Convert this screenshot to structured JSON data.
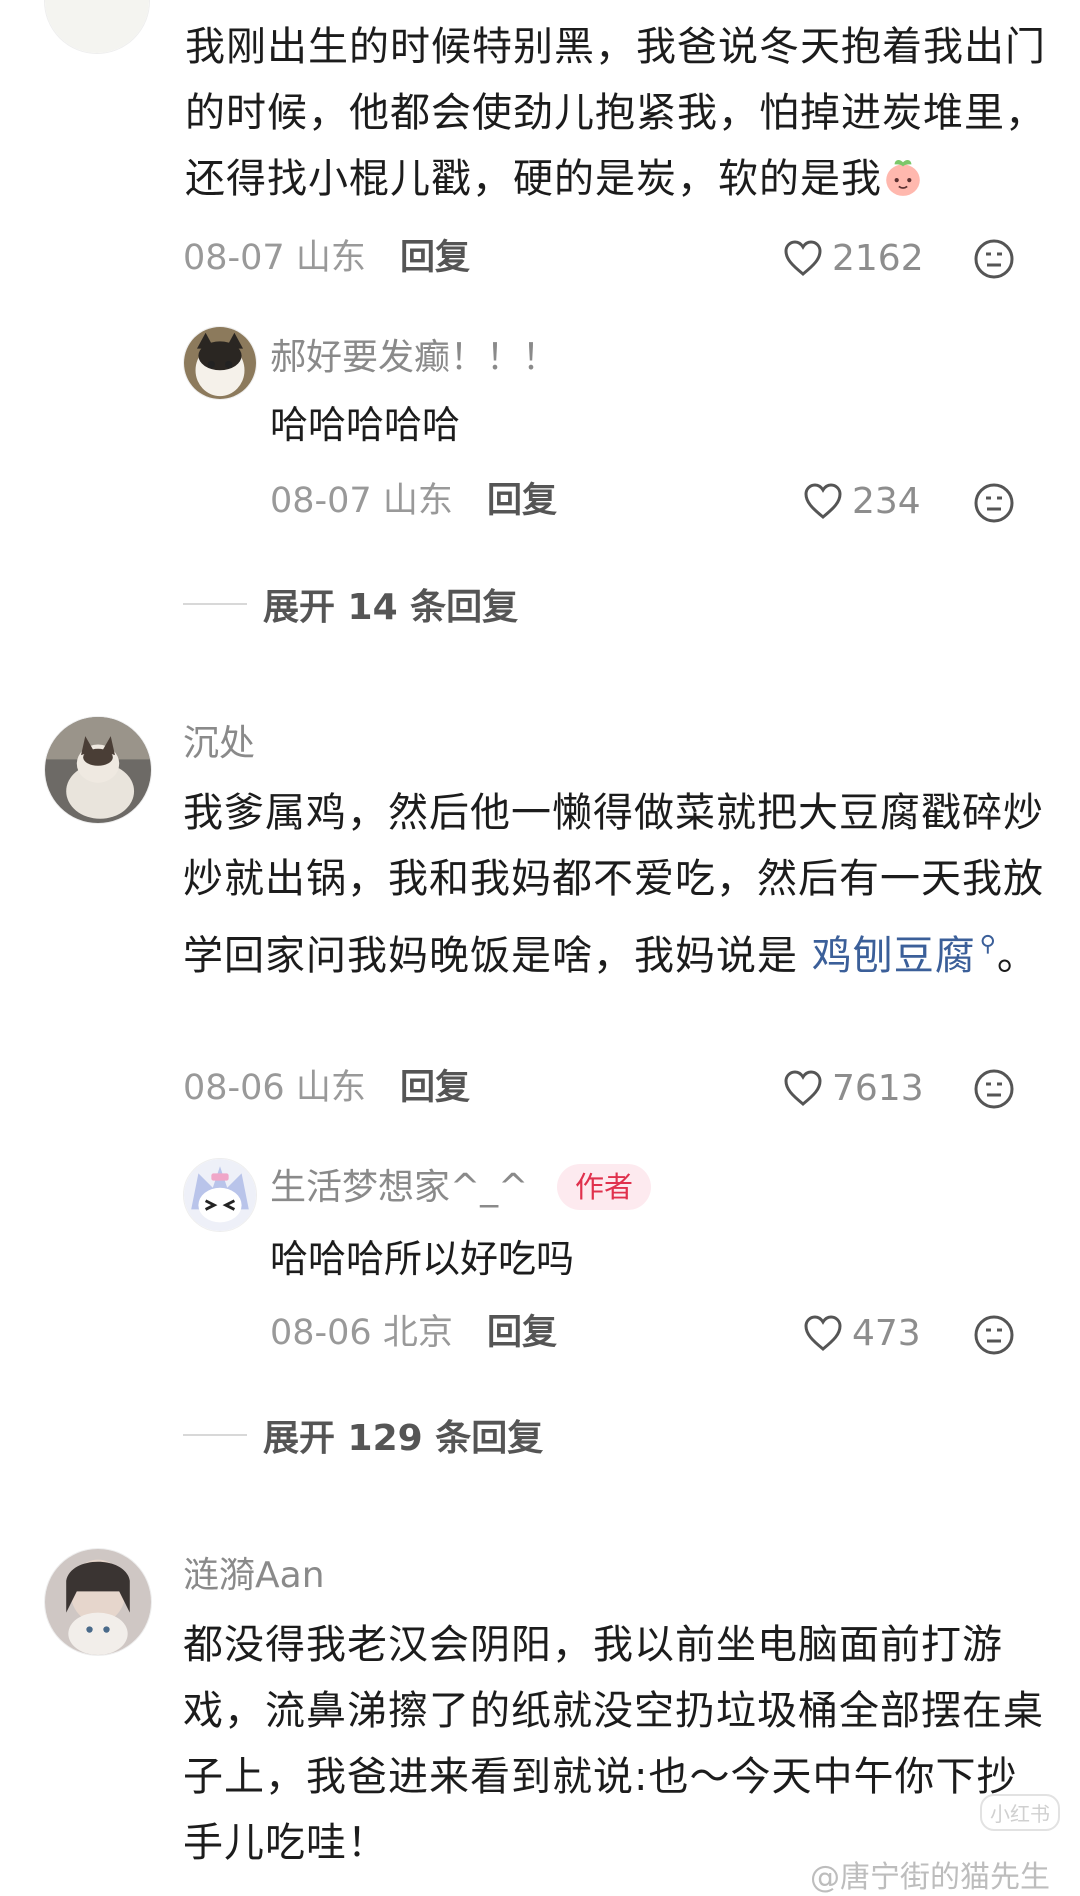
{
  "comments": [
    {
      "text": "我刚出生的时候特别黑，我爸说冬天抱着我出门的时候，他都会使劲儿抱紧我，怕掉进炭堆里，还得找小棍儿戳，硬的是炭，软的是我",
      "emoji": "peach-face-emoji",
      "date": "08-07",
      "location": "山东",
      "reply_label": "回复",
      "likes": "2162",
      "reply": {
        "name": "郝好要发癫！！！",
        "text": "哈哈哈哈哈",
        "date": "08-07",
        "location": "山东",
        "reply_label": "回复",
        "likes": "234"
      },
      "expand_label": "展开 14 条回复"
    },
    {
      "name": "沉处",
      "text_before_link": "我爹属鸡，然后他一懒得做菜就把大豆腐戳碎炒炒就出锅，我和我妈都不爱吃，然后有一天我放学回家问我妈晚饭是啥，我妈说是 ",
      "link_text": "鸡刨豆腐",
      "text_after_link": "。",
      "date": "08-06",
      "location": "山东",
      "reply_label": "回复",
      "likes": "7613",
      "reply": {
        "name": "生活梦想家^_^",
        "badge": "作者",
        "text": "哈哈哈所以好吃吗",
        "date": "08-06",
        "location": "北京",
        "reply_label": "回复",
        "likes": "473"
      },
      "expand_label": "展开 129 条回复"
    },
    {
      "name": "涟漪Aan",
      "text": "都没得我老汉会阴阳，我以前坐电脑面前打游戏，流鼻涕擦了的纸就没空扔垃圾桶全部摆在桌子上，我爸进来看到就说:也～今天中午你下抄手儿吃哇！"
    }
  ],
  "watermark": {
    "text": "@唐宁街的猫先生",
    "logo": "小红书"
  },
  "colors": {
    "link": "#3b5f99",
    "author_badge_bg": "#fdeaef",
    "author_badge_text": "#e0314d",
    "meta_gray": "#999999"
  }
}
